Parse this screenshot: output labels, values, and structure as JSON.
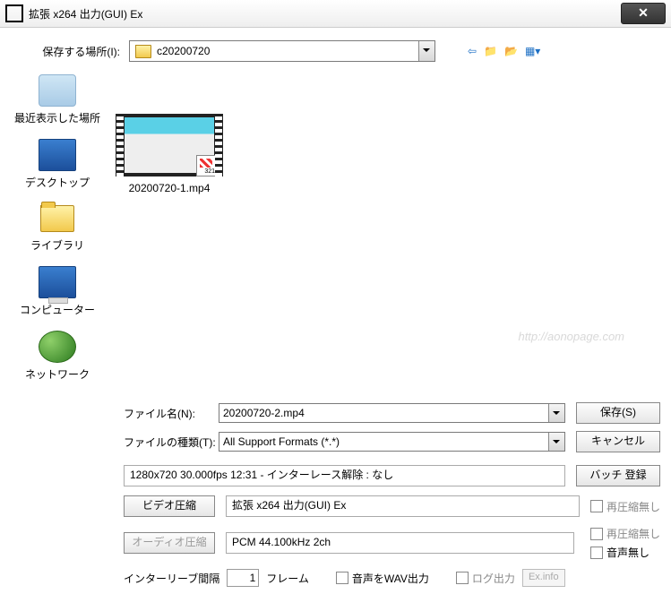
{
  "title": "拡張 x264 出力(GUI) Ex",
  "saveLocLabel": "保存する場所(I):",
  "saveLocValue": "c20200720",
  "places": {
    "recent": "最近表示した場所",
    "desktop": "デスクトップ",
    "library": "ライブラリ",
    "computer": "コンピューター",
    "network": "ネットワーク"
  },
  "thumb": {
    "badge": "321",
    "filename": "20200720-1.mp4"
  },
  "watermark": "http://aonopage.com",
  "filenameLabel": "ファイル名(N):",
  "filenameValue": "20200720-2.mp4",
  "filetypeLabel": "ファイルの種類(T):",
  "filetypeValue": "All Support Formats (*.*)",
  "saveBtn": "保存(S)",
  "cancelBtn": "キャンセル",
  "info": "1280x720  30.000fps  12:31   -   インターレース解除 : なし",
  "batchBtn": "バッチ 登録",
  "videoBtn": "ビデオ圧縮",
  "videoCodec": "拡張 x264 出力(GUI) Ex",
  "audioBtn": "オーディオ圧縮",
  "audioCodec": "PCM 44.100kHz 2ch",
  "noRecompress": "再圧縮無し",
  "noAudio": "音声無し",
  "interleaveLabel": "インターリーブ間隔",
  "interleaveVal": "1",
  "interleaveUnit": "フレーム",
  "wavOut": "音声をWAV出力",
  "logOut": "ログ出力",
  "exinfo": "Ex.info"
}
